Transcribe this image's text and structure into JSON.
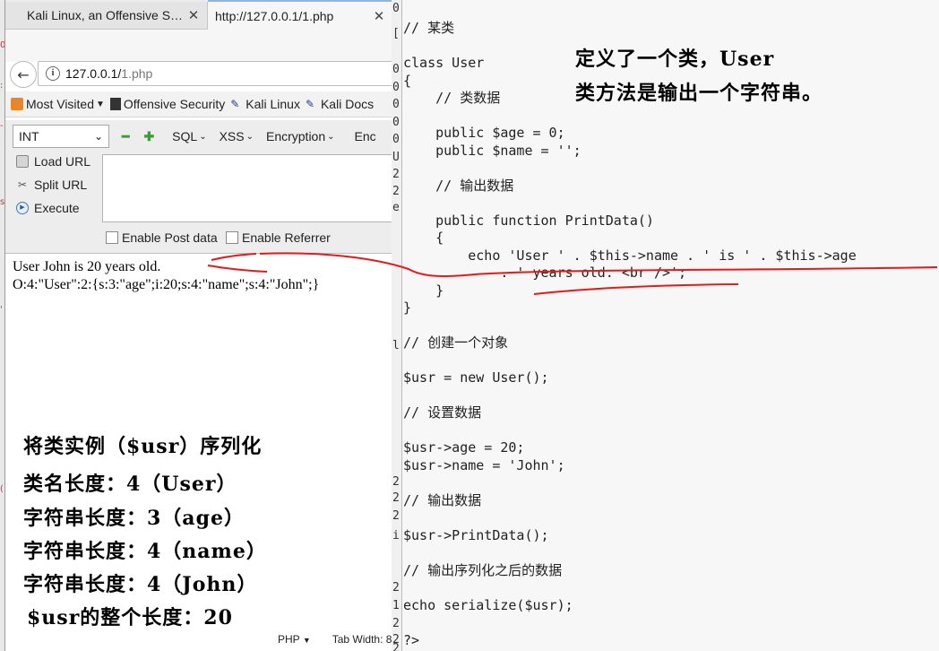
{
  "browser": {
    "tabs": [
      {
        "title": "Kali Linux, an Offensive S…"
      },
      {
        "title": "http://127.0.0.1/1.php"
      }
    ],
    "url_host": "127.0.0.1/",
    "url_path": "1.php",
    "bookmarks": [
      "Most Visited",
      "Offensive Security",
      "Kali Linux",
      "Kali Docs"
    ],
    "hackbar": {
      "select_value": "INT",
      "menus": [
        "SQL",
        "XSS",
        "Encryption",
        "Enc"
      ],
      "actions": [
        "Load URL",
        "Split URL",
        "Execute"
      ],
      "checkboxes": [
        "Enable Post data",
        "Enable Referrer"
      ]
    },
    "output": [
      "User John is 20 years old.",
      "O:4:\"User\":2:{s:3:\"age\";i:20;s:4:\"name\";s:4:\"John\";}"
    ]
  },
  "annotations": {
    "left": [
      "将类实例（$usr）序列化",
      "类名长度：4（User）",
      "字符串长度：3（age）",
      "字符串长度：4（name）",
      "字符串长度：4（John）",
      "$usr的整个长度：20"
    ],
    "right": [
      "定义了一个类，User",
      "类方法是输出一个字符串。"
    ]
  },
  "editor": {
    "code": "// 某类\n\nclass User\n{\n    // 类数据\n\n    public $age = 0;\n    public $name = '';\n\n    // 输出数据\n\n    public function PrintData()\n    {\n        echo 'User ' . $this->name . ' is ' . $this->age\n            . ' years old. <br />';\n    }\n}\n\n// 创建一个对象\n\n$usr = new User();\n\n// 设置数据\n\n$usr->age = 20;\n$usr->name = 'John';\n\n// 输出数据\n\n$usr->PrintData();\n\n// 输出序列化之后的数据\n\necho serialize($usr);\n\n?>",
    "status_lang": "PHP",
    "status_tab": "Tab Width: 8",
    "gutter_chars": [
      "0",
      "[",
      "0",
      "0",
      "0",
      "0",
      "0",
      "U",
      "2",
      "2",
      "e",
      "l",
      "2",
      "2",
      "2",
      "i",
      "2",
      "1",
      "2",
      "2",
      "2"
    ]
  }
}
